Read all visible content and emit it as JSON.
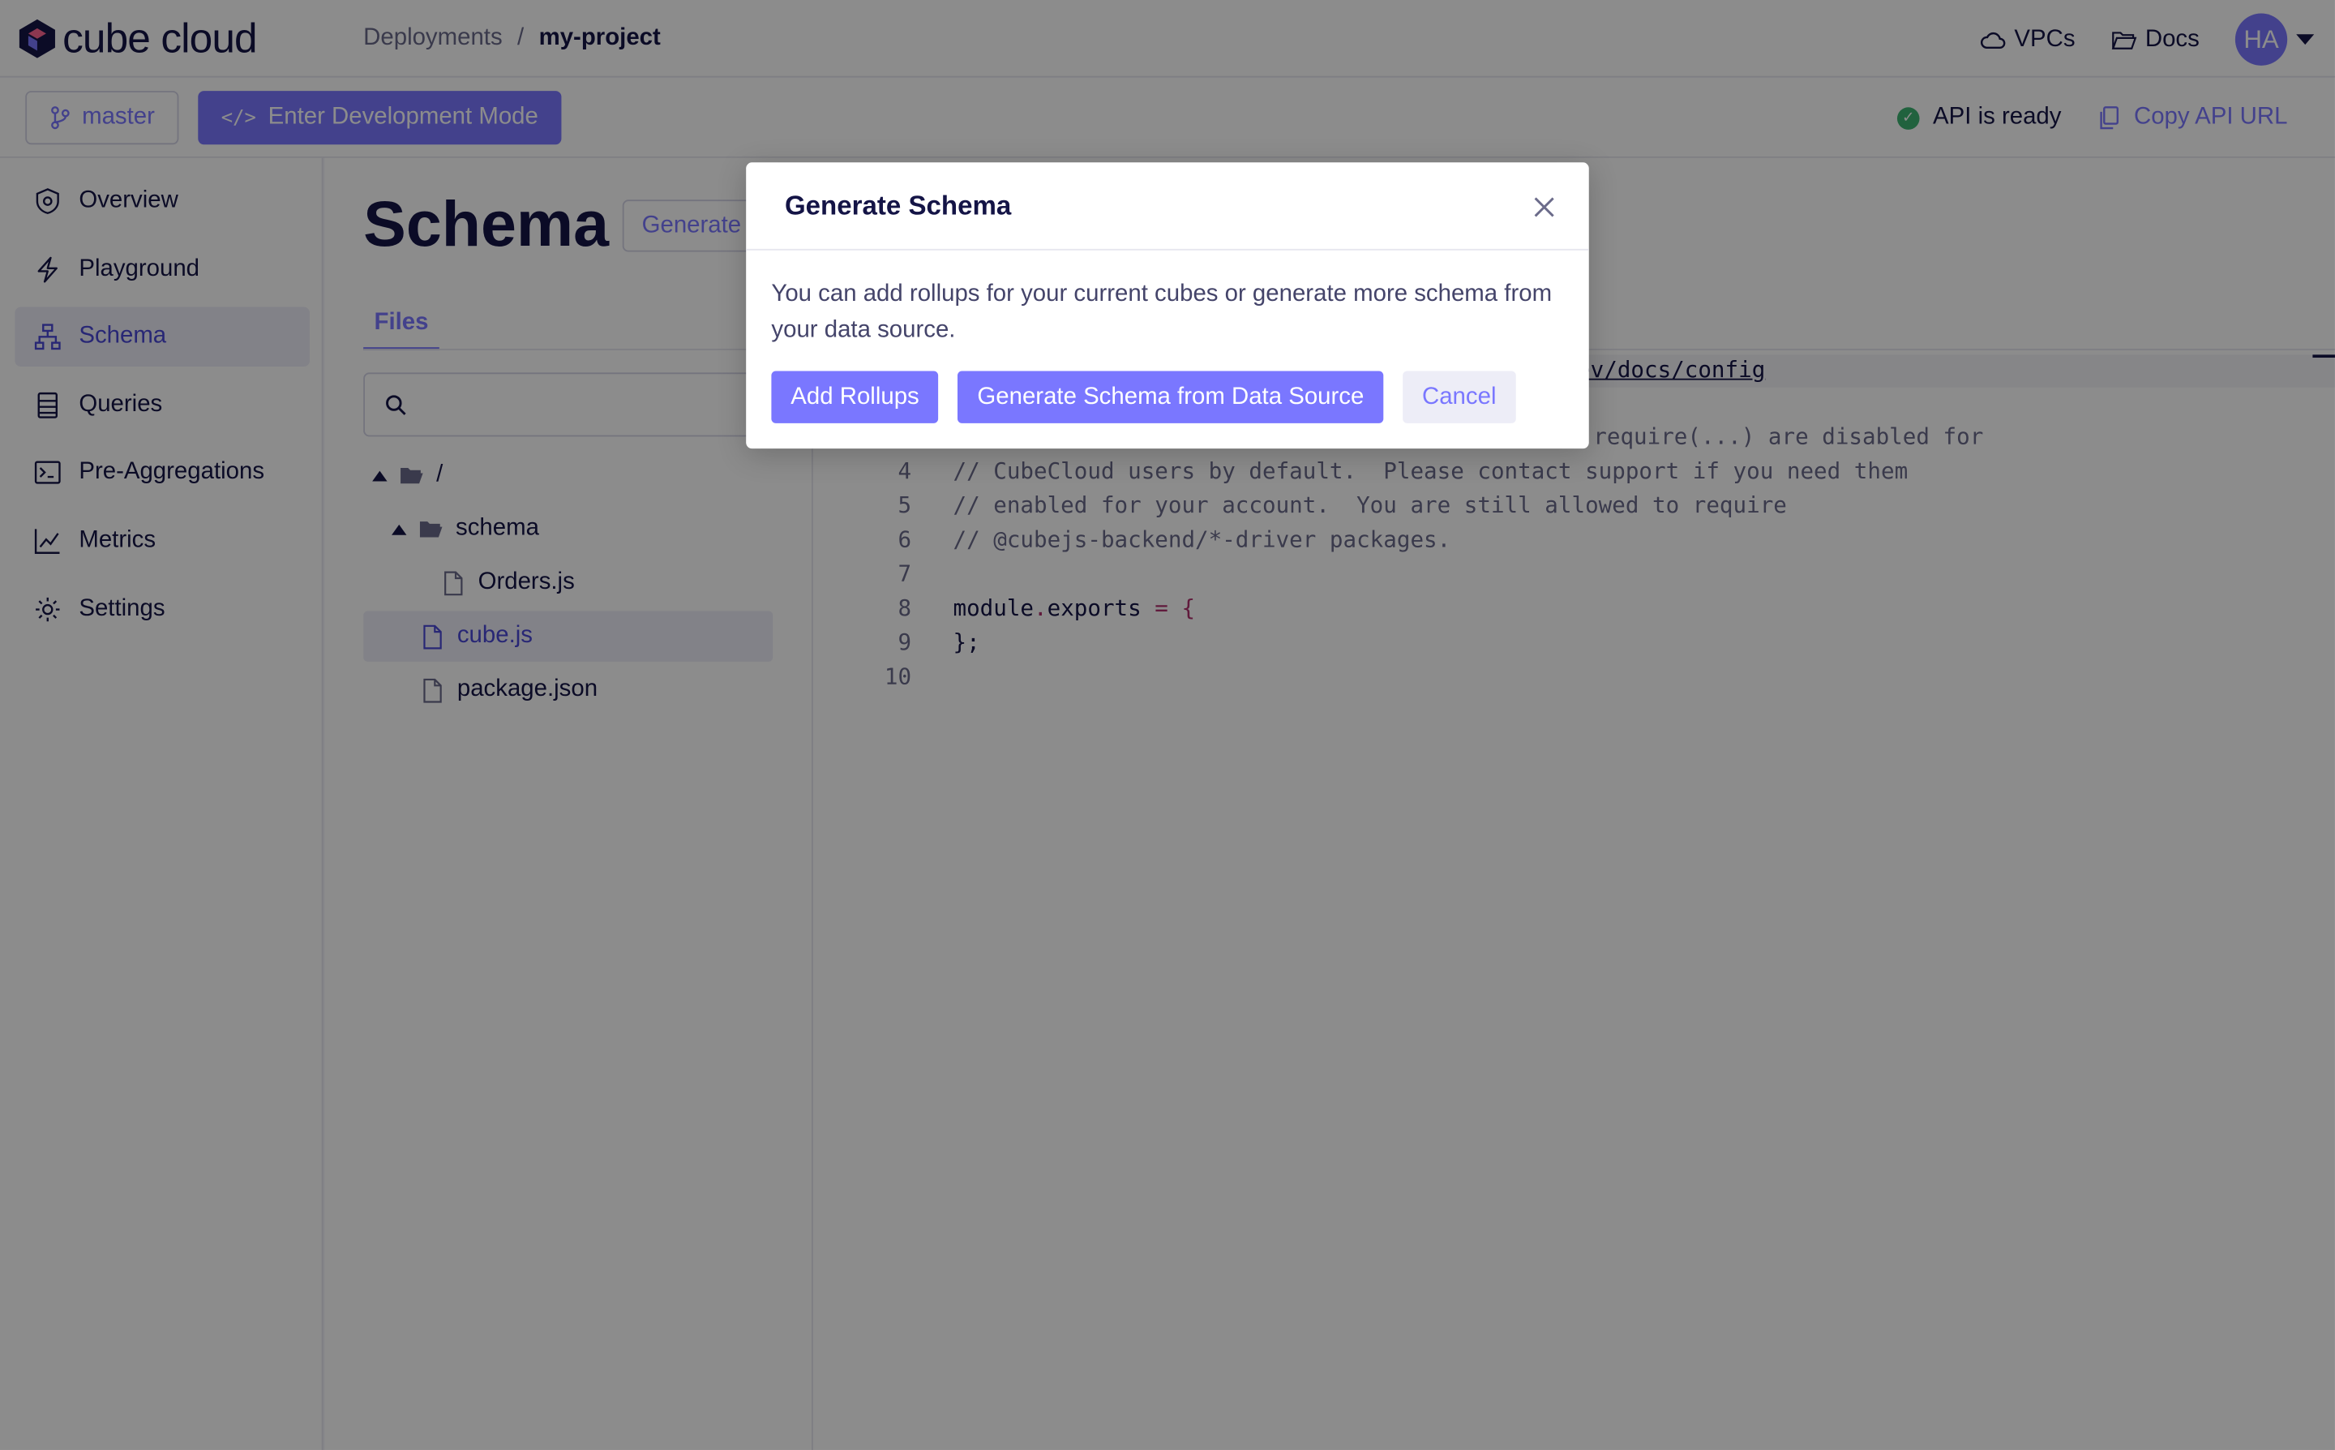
{
  "header": {
    "logo_text": "cube cloud",
    "breadcrumb": [
      "Deployments",
      "/",
      "my-project"
    ],
    "vpcs_label": "VPCs",
    "docs_label": "Docs",
    "avatar_initials": "HA"
  },
  "toolbar": {
    "branch_label": "master",
    "devmode_glyph": "</>",
    "devmode_label": "Enter Development Mode",
    "api_status": "API is ready",
    "copy_api_label": "Copy API URL"
  },
  "sidebar": {
    "items": [
      {
        "label": "Overview",
        "icon": "shield-icon"
      },
      {
        "label": "Playground",
        "icon": "lightning-icon"
      },
      {
        "label": "Schema",
        "icon": "schema-icon",
        "active": true
      },
      {
        "label": "Queries",
        "icon": "list-icon"
      },
      {
        "label": "Pre-Aggregations",
        "icon": "terminal-icon"
      },
      {
        "label": "Metrics",
        "icon": "chart-line-icon"
      },
      {
        "label": "Settings",
        "icon": "gear-icon"
      }
    ]
  },
  "main": {
    "title": "Schema",
    "generate_label": "Generate Schema",
    "tab_files": "Files",
    "search_placeholder": "",
    "tree": {
      "root": "/",
      "schema_folder": "schema",
      "orders_file": "Orders.js",
      "cube_file": "cube.js",
      "package_file": "package.json"
    },
    "editor": {
      "url_fragment": "ev/docs/config",
      "line3_fragment": "require(...) are disabled for",
      "lines": [
        {
          "n": "4",
          "text": "// CubeCloud users by default.  Please contact support if you need them"
        },
        {
          "n": "5",
          "text": "// enabled for your account.  You are still allowed to require"
        },
        {
          "n": "6",
          "text": "// @cubejs-backend/*-driver packages."
        },
        {
          "n": "7",
          "text": ""
        },
        {
          "n": "8",
          "a": "module",
          "dot": ".",
          "b": "exports ",
          "eq": "=",
          "c": " ",
          "brace": "{"
        },
        {
          "n": "9",
          "close": "};"
        },
        {
          "n": "10",
          "text": ""
        }
      ]
    }
  },
  "modal": {
    "title": "Generate Schema",
    "body": "You can add rollups for your current cubes or generate more schema from your data source.",
    "add_rollups": "Add Rollups",
    "generate_from_source": "Generate Schema from Data Source",
    "cancel": "Cancel"
  },
  "colors": {
    "accent": "#7a77ff",
    "text": "#141446",
    "ok": "#3cb371"
  }
}
